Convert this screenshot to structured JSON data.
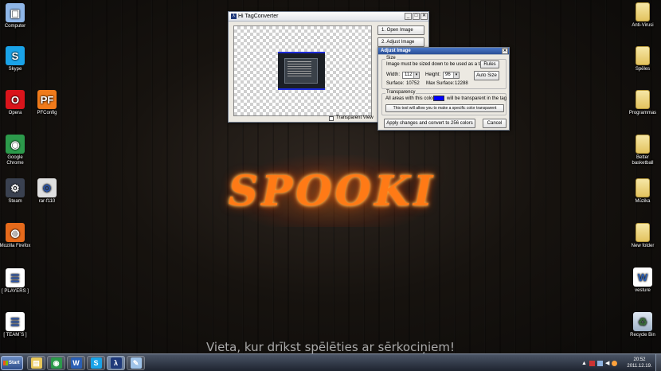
{
  "desktop": {
    "left_icons": [
      {
        "label": "Computer",
        "glyph": "▣",
        "icon": "computer-icon",
        "color": "#8fb6e8"
      },
      {
        "label": "Skype",
        "glyph": "S",
        "icon": "skype-icon",
        "color": "#1aa3e8"
      },
      {
        "label": "Opera",
        "glyph": "O",
        "icon": "opera-icon",
        "color": "#d9141b"
      },
      {
        "label": "Google Chrome",
        "glyph": "◉",
        "icon": "chrome-icon",
        "color": "#2c9a4b"
      },
      {
        "label": "Steam",
        "glyph": "⚙",
        "icon": "steam-icon",
        "color": "#3a4150"
      },
      {
        "label": "Mozilla Firefox",
        "glyph": "◍",
        "icon": "firefox-icon",
        "color": "#e66a1b"
      },
      {
        "label": "[ PLAYERS ]",
        "glyph": "☰",
        "icon": "document-icon",
        "color": "#ffffff"
      },
      {
        "label": "[ TEAM`S ]",
        "glyph": "☰",
        "icon": "document-icon",
        "color": "#ffffff"
      }
    ],
    "second_column_icons": [
      {
        "label": "PFConfig",
        "glyph": "PF",
        "icon": "pfconfig-icon",
        "color": "#f07a1a"
      },
      {
        "label": "rar-f110",
        "glyph": "⚙",
        "icon": "archive-icon",
        "color": "#e0e0e0"
      }
    ],
    "right_icons": [
      {
        "label": "Anti-Virusi",
        "icon": "folder-icon"
      },
      {
        "label": "Spēles",
        "icon": "folder-icon"
      },
      {
        "label": "Programmas",
        "icon": "folder-icon"
      },
      {
        "label": "Better basketball",
        "icon": "folder-icon"
      },
      {
        "label": "Mūzika",
        "icon": "folder-icon"
      },
      {
        "label": "New folder",
        "icon": "folder-icon"
      },
      {
        "label": "vesture",
        "icon": "word-doc-icon"
      },
      {
        "label": "Recycle Bin",
        "icon": "recycle-bin-icon"
      }
    ],
    "wallpaper_logo": "SPOOKI",
    "wallpaper_slogan": "Vieta, kur drīkst spēlēties ar sērkociņiem!"
  },
  "hitag_window": {
    "title": "Hi TagConverter",
    "open_image_label": "1.  Open Image",
    "adjust_image_label": "2.  Adjust Image",
    "transparent_view_label": "Transparent View"
  },
  "adjust_dialog": {
    "title": "Adjust Image",
    "size_group": "Size",
    "size_hint": "Image must be sized down to be used as a tag:",
    "rules_label": "Rules",
    "width_label": "Width:",
    "width_value": "112",
    "height_label": "Height:",
    "height_value": "96",
    "auto_size_label": "Auto Size",
    "surface_label": "Surface:",
    "surface_value": "10752",
    "max_surface_label": "Max Surface:",
    "max_surface_value": "12288",
    "transparency_group": "Transparency",
    "transparency_hint_1": "All areas with this color:",
    "transparency_hint_2": "will be transparent in the tag",
    "transparent_color": "#0000ff",
    "specific_color_label": "This tool will allow you to make a specific color transparent",
    "apply_label": "Apply changes and convert to 256 colors",
    "cancel_label": "Cancel"
  },
  "taskbar": {
    "start_label": "Start",
    "buttons": [
      {
        "icon": "explorer-folder-icon",
        "glyph": "▤",
        "color": "#e8c75a"
      },
      {
        "icon": "chrome-icon",
        "glyph": "◉",
        "color": "#2c9a4b"
      },
      {
        "icon": "word-icon",
        "glyph": "W",
        "color": "#2b5fb4"
      },
      {
        "icon": "skype-icon",
        "glyph": "S",
        "color": "#1aa3e8"
      },
      {
        "icon": "hitag-icon",
        "glyph": "λ",
        "color": "#203a7a"
      },
      {
        "icon": "paint-icon",
        "glyph": "✎",
        "color": "#9fc3e8"
      }
    ],
    "clock_time": "20:52",
    "clock_date": "2011.12.19."
  }
}
